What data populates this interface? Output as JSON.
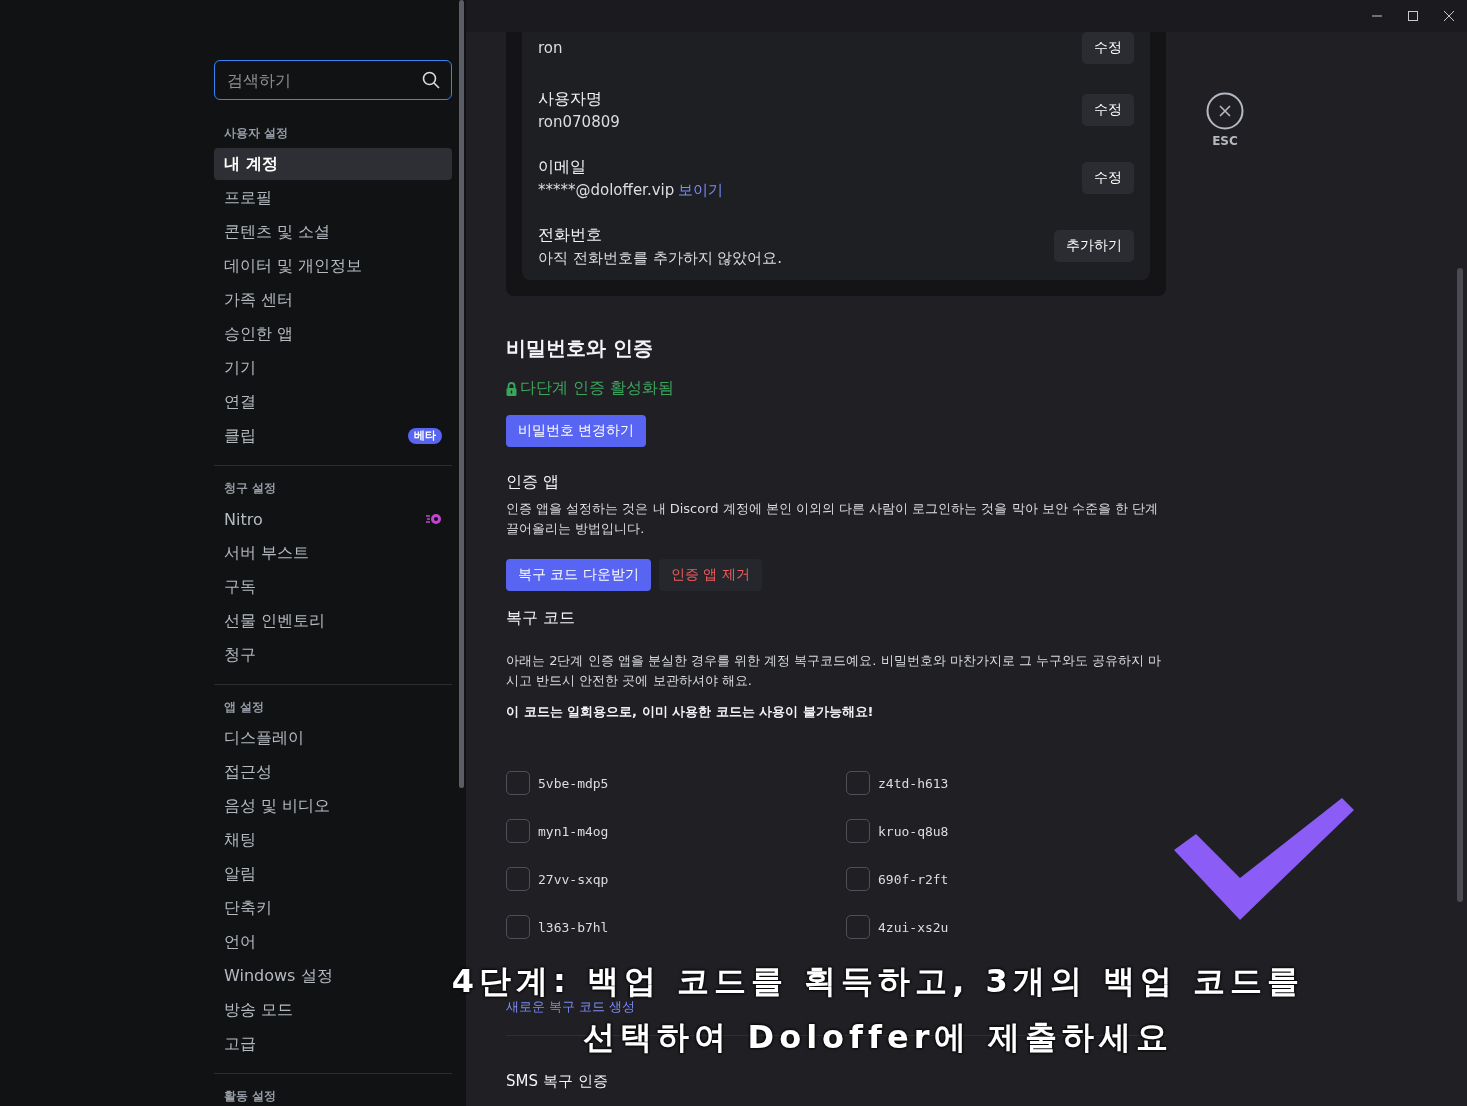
{
  "sidebar": {
    "search": {
      "placeholder": "검색하기"
    },
    "sections": [
      {
        "title": "사용자 설정",
        "items": [
          {
            "label": "내 계정",
            "selected": true,
            "kind": "plain"
          },
          {
            "label": "프로필",
            "selected": false,
            "kind": "plain"
          },
          {
            "label": "콘텐츠 및 소셜",
            "selected": false,
            "kind": "plain"
          },
          {
            "label": "데이터 및 개인정보",
            "selected": false,
            "kind": "plain"
          },
          {
            "label": "가족 센터",
            "selected": false,
            "kind": "plain"
          },
          {
            "label": "승인한 앱",
            "selected": false,
            "kind": "plain"
          },
          {
            "label": "기기",
            "selected": false,
            "kind": "plain"
          },
          {
            "label": "연결",
            "selected": false,
            "kind": "plain"
          },
          {
            "label": "클립",
            "selected": false,
            "kind": "badge",
            "badge": "베타"
          }
        ]
      },
      {
        "title": "청구 설정",
        "items": [
          {
            "label": "Nitro",
            "selected": false,
            "kind": "nitro"
          },
          {
            "label": "서버 부스트",
            "selected": false,
            "kind": "plain"
          },
          {
            "label": "구독",
            "selected": false,
            "kind": "plain"
          },
          {
            "label": "선물 인벤토리",
            "selected": false,
            "kind": "plain"
          },
          {
            "label": "청구",
            "selected": false,
            "kind": "plain"
          }
        ]
      },
      {
        "title": "앱 설정",
        "items": [
          {
            "label": "디스플레이",
            "selected": false,
            "kind": "plain"
          },
          {
            "label": "접근성",
            "selected": false,
            "kind": "plain"
          },
          {
            "label": "음성 및 비디오",
            "selected": false,
            "kind": "plain"
          },
          {
            "label": "채팅",
            "selected": false,
            "kind": "plain"
          },
          {
            "label": "알림",
            "selected": false,
            "kind": "plain"
          },
          {
            "label": "단축키",
            "selected": false,
            "kind": "plain"
          },
          {
            "label": "언어",
            "selected": false,
            "kind": "plain"
          },
          {
            "label": "Windows 설정",
            "selected": false,
            "kind": "plain"
          },
          {
            "label": "방송 모드",
            "selected": false,
            "kind": "plain"
          },
          {
            "label": "고급",
            "selected": false,
            "kind": "plain"
          }
        ]
      },
      {
        "title": "활동 설정"
      }
    ]
  },
  "account_card": {
    "rows": [
      {
        "value": "ron",
        "button": "수정"
      },
      {
        "label": "사용자명",
        "value": "ron070809",
        "button": "수정"
      },
      {
        "label": "이메일",
        "value": "*****@doloffer.vip",
        "link": "보이기",
        "button": "수정"
      },
      {
        "label": "전화번호",
        "value": "아직 전화번호를 추가하지 않았어요.",
        "button": "추가하기"
      }
    ]
  },
  "close": {
    "label": "ESC"
  },
  "password_auth": {
    "heading": "비밀번호와 인증",
    "mfa_status": "다단계 인증 활성화됨",
    "change_password_button": "비밀번호 변경하기",
    "auth_app": {
      "title": "인증 앱",
      "description": "인증 앱을 설정하는 것은 내 Discord 계정에 본인 이외의 다른 사람이 로그인하는 것을 막아 보안 수준을 한 단계 끌어올리는 방법입니다.",
      "buttons": [
        {
          "label": "복구 코드 다운받기",
          "kind": "primary"
        },
        {
          "label": "인증 앱 제거",
          "kind": "danger"
        }
      ]
    },
    "backup_codes": {
      "title": "복구 코드",
      "description": "아래는 2단계 인증 앱을 분실한 경우를 위한 계정 복구코드예요. 비밀번호와 마찬가지로 그 누구와도 공유하지 마시고 반드시 안전한 곳에 보관하셔야 해요.",
      "warning": "이 코드는 일회용으로, 이미 사용한 코드는 사용이 불가능해요!",
      "codes": [
        {
          "code": "5vbe-mdp5",
          "checked": false
        },
        {
          "code": "z4td-h613",
          "checked": false
        },
        {
          "code": "myn1-m4og",
          "checked": false
        },
        {
          "code": "kruo-q8u8",
          "checked": false
        },
        {
          "code": "27vv-sxqp",
          "checked": false
        },
        {
          "code": "690f-r2ft",
          "checked": false
        },
        {
          "code": "l363-b7hl",
          "checked": false
        },
        {
          "code": "4zui-xs2u",
          "checked": false
        }
      ],
      "regenerate_link": "새로운 복구 코드 생성"
    },
    "sms": {
      "title": "SMS 복구 인증"
    }
  },
  "overlay": {
    "caption_lines": [
      "4단계: 백업 코드를 획득하고, 3개의 백업 코드를",
      "선택하여 Doloffer에 제출하세요"
    ]
  }
}
